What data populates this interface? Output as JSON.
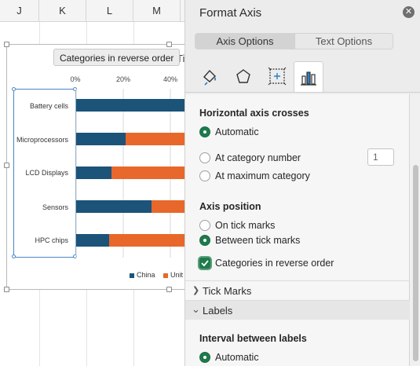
{
  "sheet": {
    "columns": [
      "J",
      "K",
      "L",
      "M"
    ]
  },
  "chart": {
    "tooltip": "Categories in reverse order",
    "title_fragment": "Ti",
    "x_ticks": [
      "0%",
      "20%",
      "40%"
    ],
    "legend": [
      {
        "label": "China",
        "color": "#1b5379"
      },
      {
        "label": "Unit",
        "color": "#e8672a"
      }
    ]
  },
  "chart_data": {
    "type": "bar",
    "categories": [
      "Battery cells",
      "Microprocessors",
      "LCD Displays",
      "Sensors",
      "HPC chips"
    ],
    "series": [
      {
        "name": "China",
        "values": [
          48,
          21,
          15,
          32,
          14
        ]
      },
      {
        "name": "Unit",
        "values": [
          52,
          79,
          85,
          68,
          86
        ]
      }
    ],
    "stacked": true,
    "xlim": [
      0,
      100
    ],
    "x_tick_format": "percent",
    "grid": true,
    "legend_position": "bottom",
    "colors": {
      "China": "#1b5379",
      "Unit": "#e8672a"
    }
  },
  "pane": {
    "title": "Format Axis",
    "close_icon": "close-icon",
    "tabs": [
      "Axis Options",
      "Text Options"
    ],
    "active_tab": "Axis Options",
    "icon_tabs": [
      "fill-line-icon",
      "effects-pentagon-icon",
      "size-properties-icon",
      "axis-options-bars-icon"
    ],
    "sections": {
      "crosses": {
        "heading": "Horizontal axis crosses",
        "options": [
          "Automatic",
          "At category number",
          "At maximum category"
        ],
        "selected": "Automatic",
        "category_number_value": "1"
      },
      "position": {
        "heading": "Axis position",
        "options": [
          "On tick marks",
          "Between tick marks"
        ],
        "selected": "Between tick marks",
        "reverse_label": "Categories in reverse order",
        "reverse_checked": true
      },
      "tick_marks": "Tick Marks",
      "labels": "Labels",
      "interval": {
        "heading": "Interval between labels",
        "option": "Automatic"
      }
    }
  }
}
